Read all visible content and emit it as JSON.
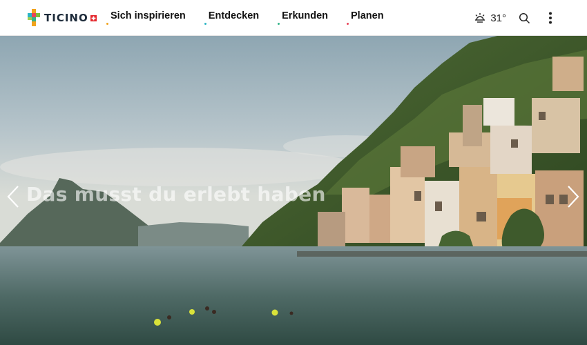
{
  "header": {
    "logo_text": "TICINO",
    "nav": [
      {
        "label": "Sich inspirieren",
        "dot_color": "#f2a31b"
      },
      {
        "label": "Entdecken",
        "dot_color": "#2bb5c4"
      },
      {
        "label": "Erkunden",
        "dot_color": "#34b58a"
      },
      {
        "label": "Planen",
        "dot_color": "#e9455a"
      }
    ],
    "weather": {
      "icon": "sun-icon",
      "temperature": "31°"
    },
    "search_icon": "search-icon",
    "menu_icon": "more-vertical-icon"
  },
  "hero": {
    "headline": "Das musst du erlebt haben",
    "prev_icon": "chevron-left-icon",
    "next_icon": "chevron-right-icon"
  },
  "colors": {
    "nav_text": "#111111",
    "logo_text": "#1d2b3a",
    "swiss_red": "#e4262c"
  }
}
